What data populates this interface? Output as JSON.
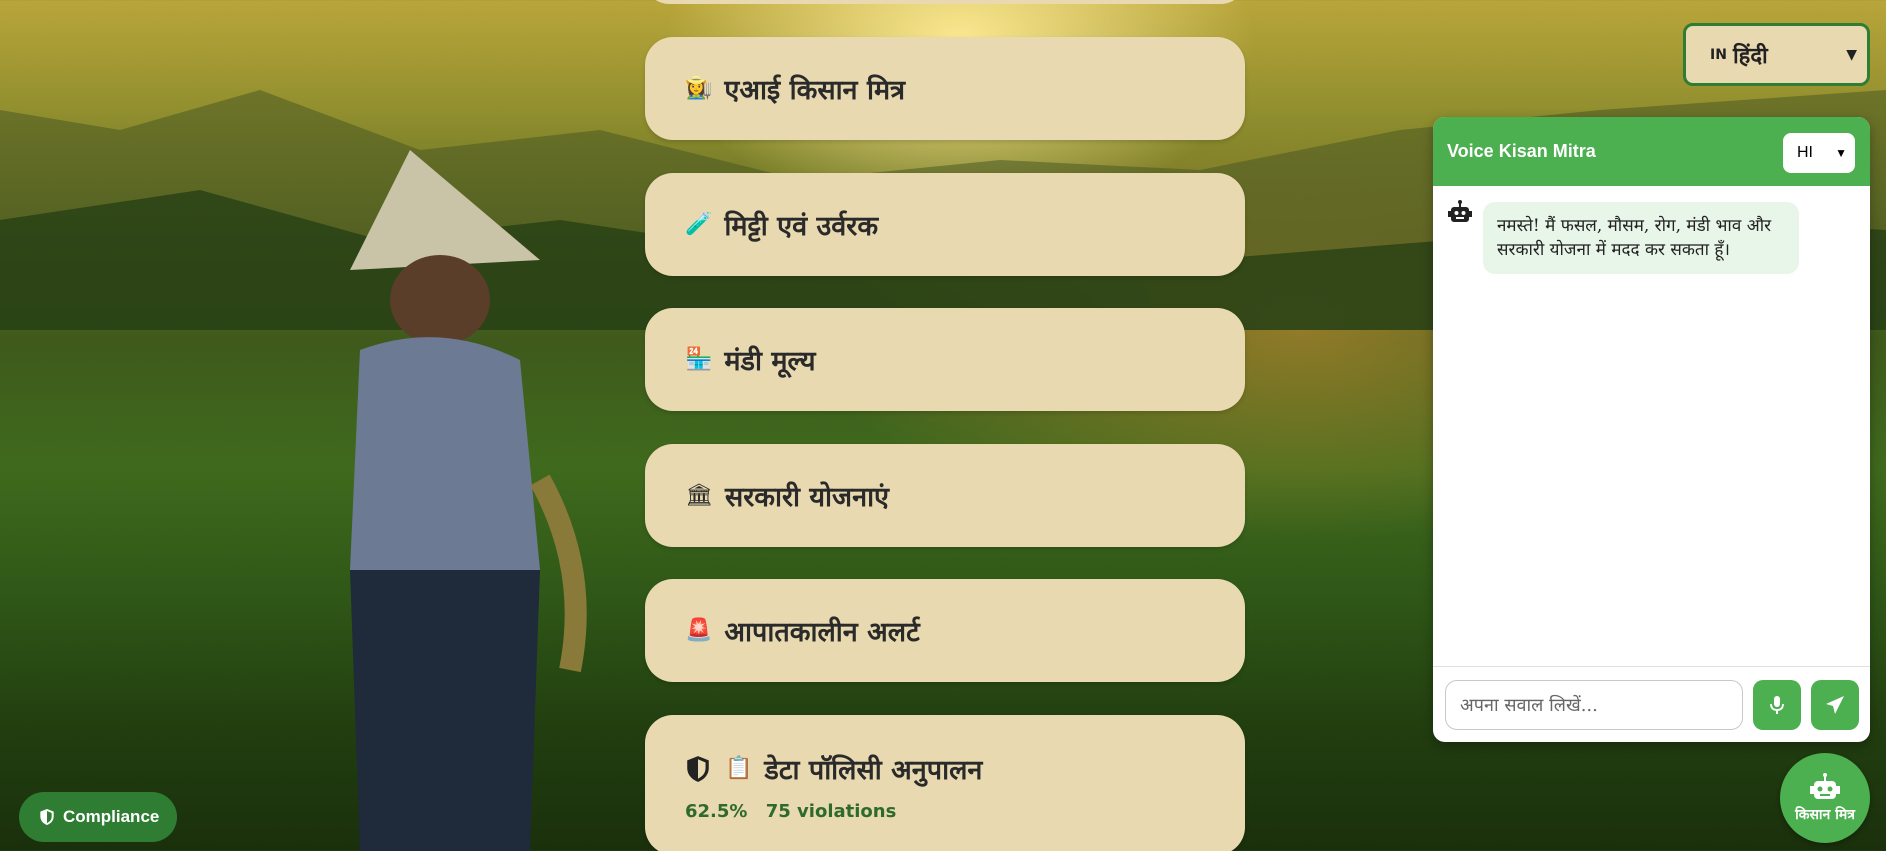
{
  "menu": {
    "cards": [
      {
        "icon": "👩‍🌾",
        "label": "एआई किसान मित्र"
      },
      {
        "icon": "🧪",
        "label": "मिट्टी एवं उर्वरक"
      },
      {
        "icon": "🏪",
        "label": "मंडी मूल्य"
      },
      {
        "icon": "🏛",
        "label": "सरकारी योजनाएं"
      },
      {
        "icon": "🚨",
        "label": "आपातकालीन अलर्ट"
      }
    ],
    "policy": {
      "icon": "📋",
      "label": "डेटा पॉलिसी अनुपालन",
      "percent": "62.5%",
      "violations": "75 violations"
    }
  },
  "language": {
    "flag": "IN",
    "selected": "हिंदी"
  },
  "chat": {
    "title": "Voice Kisan Mitra",
    "lang": "HI",
    "bot_message": "नमस्ते! मैं फसल, मौसम, रोग, मंडी भाव और सरकारी योजना में मदद कर सकता हूँ।",
    "input_placeholder": "अपना सवाल लिखें..."
  },
  "fab": {
    "label": "किसान मित्र"
  },
  "compliance": {
    "label": "Compliance"
  },
  "colors": {
    "green": "#4caf50",
    "dark_green": "#2e7d32",
    "card": "#e8d9b0"
  }
}
